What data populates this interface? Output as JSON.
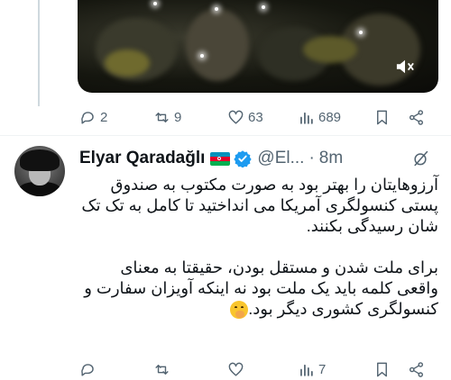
{
  "previous_tweet": {
    "actions": {
      "reply_count": "2",
      "retweet_count": "9",
      "like_count": "63",
      "view_count": "689"
    }
  },
  "tweet": {
    "display_name": "Elyar Qaradağlı",
    "handle": "@El...",
    "separator": "·",
    "time": "8m",
    "flag_country": "Azerbaijan",
    "text_paragraph_1": "آرزوهایتان را بهتر بود به صورت مکتوب به صندوق پستی کنسولگری آمریکا می انداختید تا کامل به تک تک شان رسیدگی بکنند.",
    "text_paragraph_2": "برای ملت شدن و مستقل بودن، حقیقتا به معنای واقعی کلمه باید یک ملت بود نه اینکه آویزان سفارت و کنسولگری کشوری دیگر بود.",
    "emoji": "face-with-hand-over-mouth",
    "actions": {
      "reply_count": "",
      "retweet_count": "",
      "like_count": "",
      "view_count": "7"
    }
  },
  "colors": {
    "text": "#0f1419",
    "muted": "#536471",
    "verified": "#1d9bf0",
    "divider": "#eff3f4"
  }
}
